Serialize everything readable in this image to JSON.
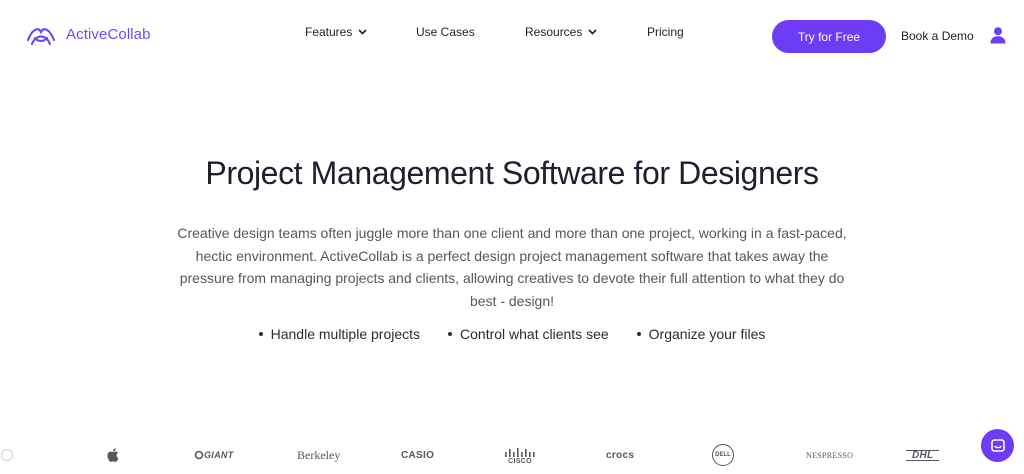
{
  "header": {
    "logo_text": "ActiveCollab",
    "nav": [
      {
        "label": "Features",
        "has_dropdown": true
      },
      {
        "label": "Use Cases",
        "has_dropdown": false
      },
      {
        "label": "Resources",
        "has_dropdown": true
      },
      {
        "label": "Pricing",
        "has_dropdown": false
      }
    ],
    "cta_label": "Try for Free",
    "demo_label": "Book a Demo",
    "user_icon": "user-icon"
  },
  "hero": {
    "title": "Project Management Software for Designers",
    "description": "Creative design teams often juggle more than one client and more than one project, working in a fast-paced, hectic environment. ActiveCollab is a perfect design project management software that takes away the pressure from managing projects and clients, allowing creatives to devote their full attention to what they do best - design!",
    "bullets": [
      "Handle multiple projects",
      "Control what clients see",
      "Organize your files"
    ]
  },
  "logos": [
    {
      "name": "apple-logo",
      "text": ""
    },
    {
      "name": "giant-logo",
      "text": "GIANT"
    },
    {
      "name": "berkeley-logo",
      "text": "Berkeley"
    },
    {
      "name": "casio-logo",
      "text": "CASIO"
    },
    {
      "name": "cisco-logo",
      "text": "CISCO"
    },
    {
      "name": "crocs-logo",
      "text": "crocs"
    },
    {
      "name": "dell-logo",
      "text": "DELL"
    },
    {
      "name": "nespresso-logo",
      "text": "NESPRESSO"
    },
    {
      "name": "dhl-logo",
      "text": "DHL"
    }
  ],
  "colors": {
    "accent": "#6c3df4",
    "logo": "#6c4cf0",
    "text": "#1f1f2e",
    "muted": "#55575e"
  },
  "chat_icon": "chat-icon"
}
